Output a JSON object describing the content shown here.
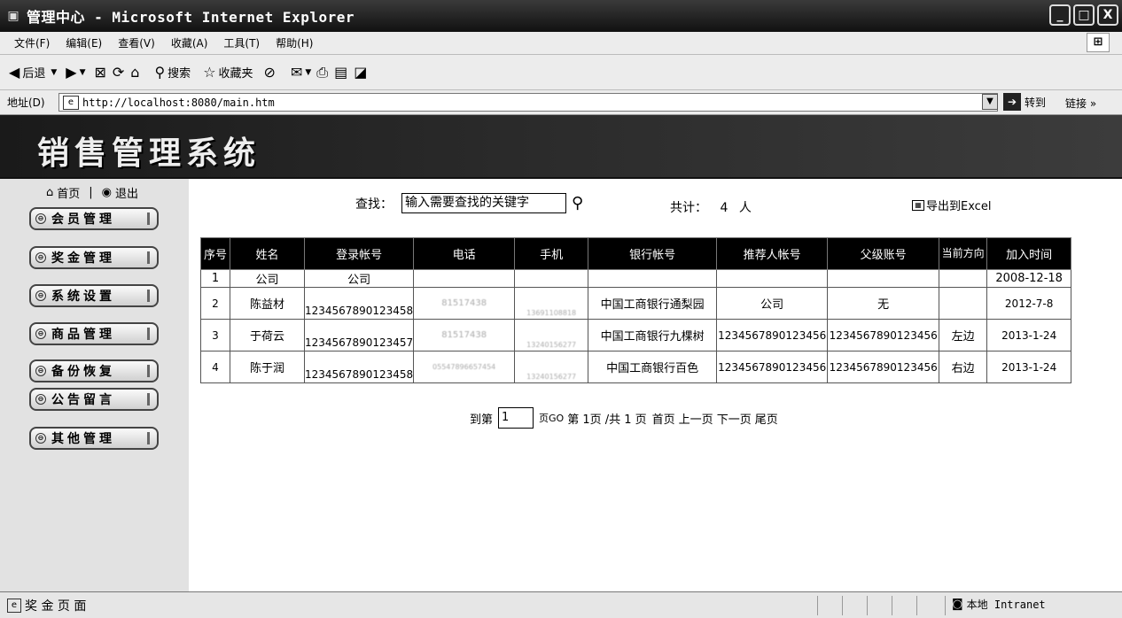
{
  "window": {
    "title": "管理中心 - Microsoft Internet Explorer",
    "minimize": "_",
    "maximize": "□",
    "close": "X"
  },
  "menu": [
    "文件(F)",
    "编辑(E)",
    "查看(V)",
    "收藏(A)",
    "工具(T)",
    "帮助(H)"
  ],
  "toolbar": {
    "back": "后退",
    "search": "搜索",
    "favorites": "收藏夹"
  },
  "address": {
    "label": "地址(D)",
    "url": "http://localhost:8080/main.htm",
    "go": "转到",
    "links": "链接 »"
  },
  "banner": {
    "title": "销售管理系统"
  },
  "sidebar": {
    "home": "首页",
    "separator": "|",
    "logout": "退出",
    "items": [
      "会员管理",
      "奖金管理",
      "系统设置",
      "商品管理",
      "备份恢复",
      "公告留言",
      "其他管理"
    ]
  },
  "search": {
    "label": "查找：",
    "placeholder": "输入需要查找的关键字",
    "total_label": "共计：",
    "total_count": "4",
    "total_unit": "人",
    "export": "导出到Excel"
  },
  "table": {
    "headers": [
      "序号",
      "姓名",
      "登录帐号",
      "电话",
      "手机",
      "银行帐号",
      "推荐人帐号",
      "父级账号",
      "当前方向",
      "加入时间"
    ],
    "rows": [
      [
        "1",
        "公司",
        "公司",
        "",
        "",
        "",
        "",
        "",
        "",
        "2008-12-18"
      ],
      [
        "2",
        "陈益材",
        "1234567890123458",
        "81517438",
        "13691108818",
        "中国工商银行通梨园",
        "公司",
        "无",
        "",
        "2012-7-8"
      ],
      [
        "3",
        "于荷云",
        "1234567890123457",
        "81517438",
        "13240156277",
        "中国工商银行九棵树",
        "1234567890123456",
        "1234567890123456",
        "左边",
        "2013-1-24"
      ],
      [
        "4",
        "陈于润",
        "1234567890123458",
        "05547896657454",
        "13240156277",
        "中国工商银行百色",
        "1234567890123456",
        "1234567890123456",
        "右边",
        "2013-1-24"
      ]
    ]
  },
  "pager": {
    "goto_label": "到第",
    "goto_value": "1",
    "goto_suffix": "页GO",
    "current": "第 1页 /共 1 页",
    "first": "首页",
    "prev": "上一页",
    "next": "下一页",
    "last": "尾页"
  },
  "status": {
    "text": "奖 金 页 面",
    "zone": "本地 Intranet"
  }
}
